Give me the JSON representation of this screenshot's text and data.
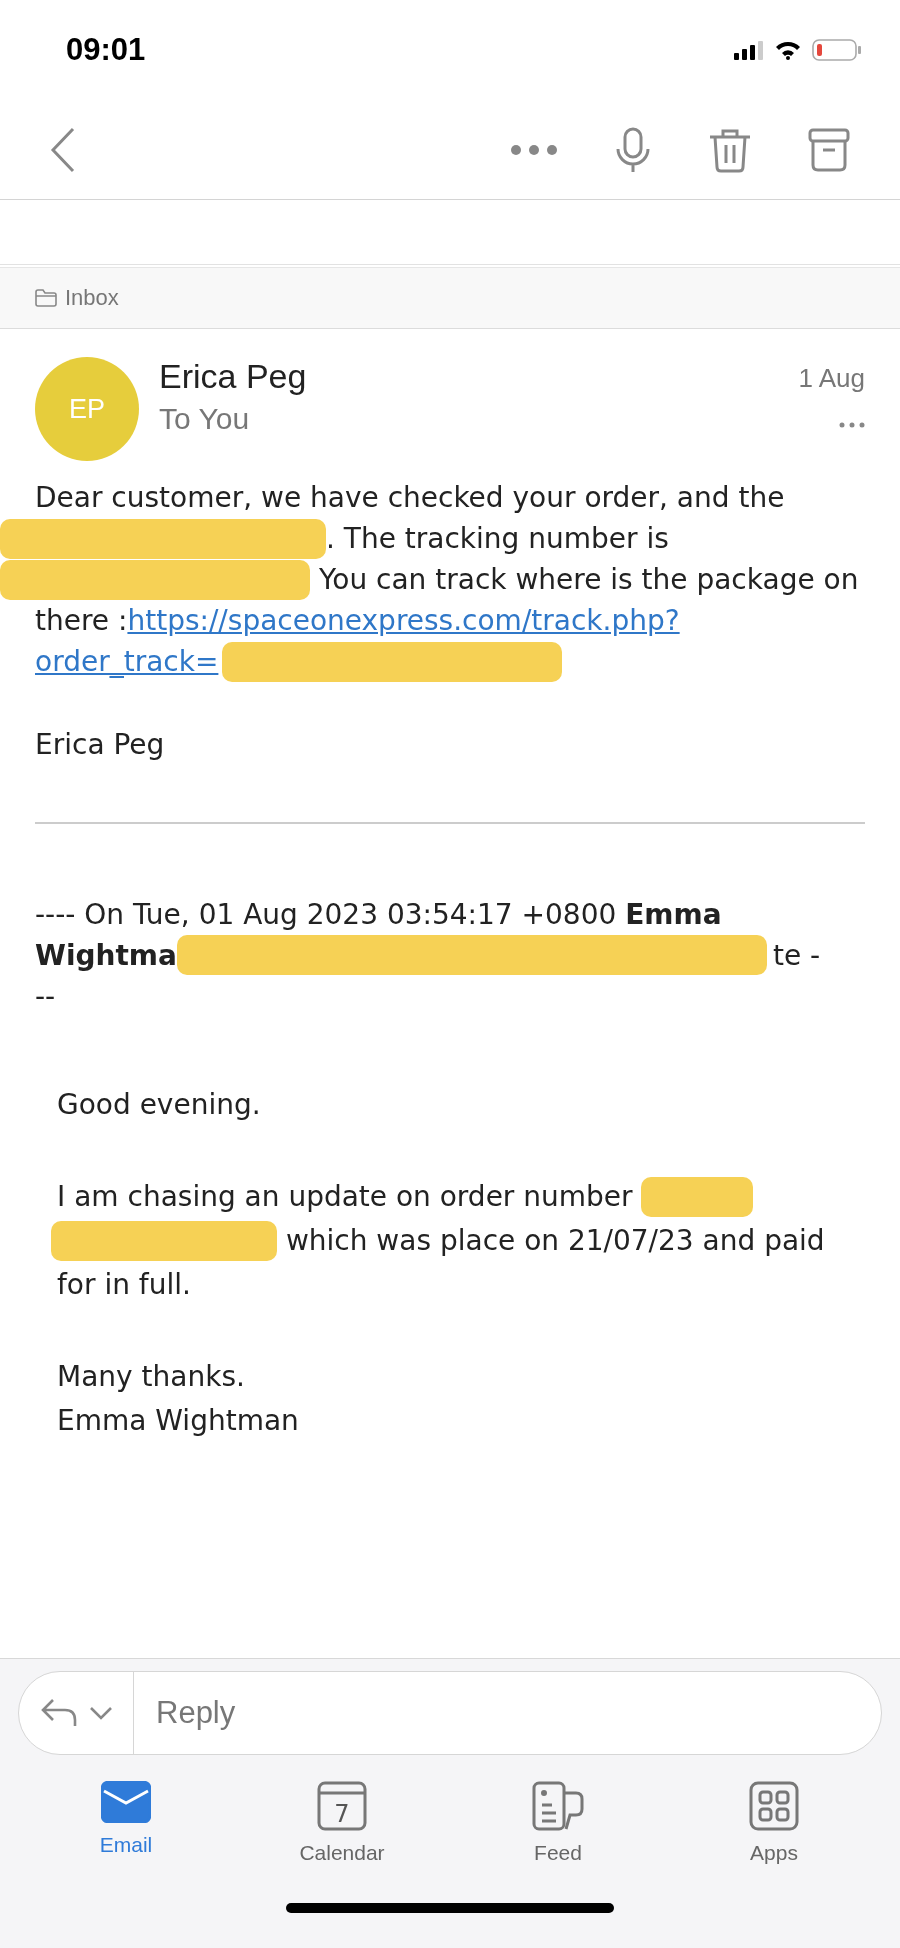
{
  "status_bar": {
    "time": "09:01"
  },
  "folder": {
    "label": "Inbox"
  },
  "message": {
    "avatar": "EP",
    "sender": "Erica Peg",
    "recipient": "To You",
    "date": "1 Aug",
    "body_lines": [
      [
        {
          "kind": "text",
          "text": "Dear customer, we have checked your order, and the"
        }
      ],
      [
        {
          "kind": "redacted"
        },
        {
          "kind": "text",
          "text": ". The tracking number is"
        }
      ],
      [
        {
          "kind": "redacted"
        },
        {
          "kind": "text",
          "text": " You can track where is the package on"
        }
      ],
      [
        {
          "kind": "text",
          "text": "there :"
        },
        {
          "kind": "link",
          "text": "https://spaceonexpress.com/track.php?"
        }
      ],
      [
        {
          "kind": "link",
          "text": "order_track="
        },
        {
          "kind": "redacted"
        }
      ]
    ],
    "signature": "Erica Peg",
    "quote_header": [
      [
        {
          "kind": "text",
          "text": "---- On Tue, 01 Aug 2023 03:54:17 +0800 "
        },
        {
          "kind": "bold",
          "text": "Emma"
        }
      ],
      [
        {
          "kind": "bold",
          "text": "Wightma"
        },
        {
          "kind": "redacted-long"
        },
        {
          "kind": "text",
          "text": "te -"
        }
      ],
      [
        {
          "kind": "text",
          "text": "--"
        }
      ]
    ],
    "quote_body": [
      [
        [
          {
            "kind": "text",
            "text": "Good evening."
          }
        ]
      ],
      [
        [
          {
            "kind": "text",
            "text": "I am chasing an update on order number "
          },
          {
            "kind": "redacted"
          }
        ],
        [
          {
            "kind": "redacted"
          },
          {
            "kind": "text",
            "text": " which was place on 21/07/23 and paid"
          }
        ],
        [
          {
            "kind": "text",
            "text": "for in full."
          }
        ]
      ],
      [
        [
          {
            "kind": "text",
            "text": "Many thanks."
          }
        ],
        [
          {
            "kind": "text",
            "text": "Emma Wightman"
          }
        ]
      ]
    ]
  },
  "reply": {
    "placeholder": "Reply"
  },
  "tabs": [
    {
      "label": "Email",
      "selected": true
    },
    {
      "label": "Calendar",
      "day": "7",
      "selected": false
    },
    {
      "label": "Feed",
      "selected": false
    },
    {
      "label": "Apps",
      "selected": false
    }
  ]
}
